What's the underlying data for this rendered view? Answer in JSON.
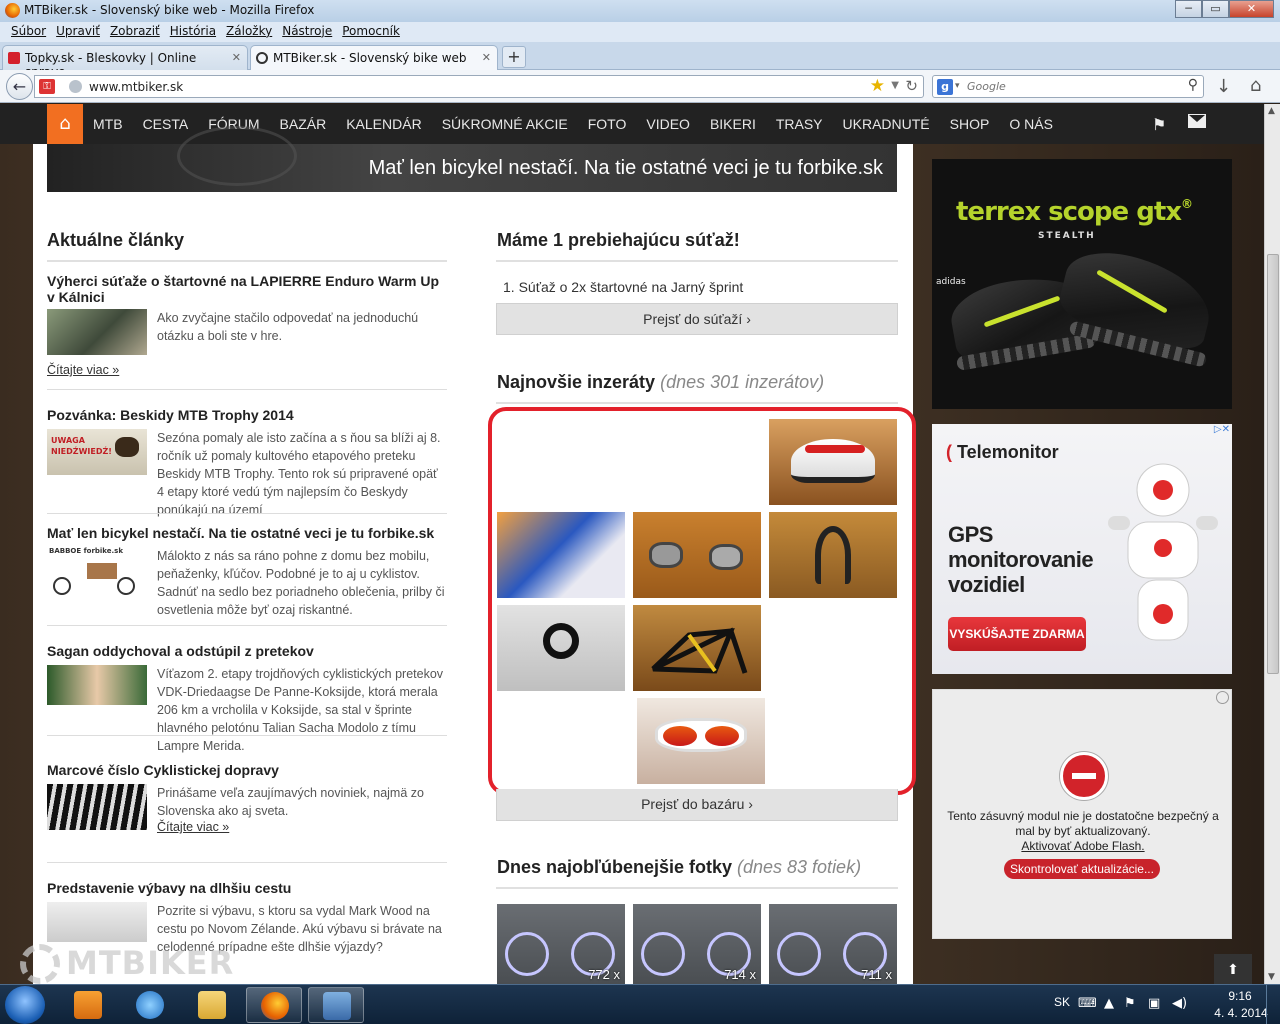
{
  "window": {
    "title": "MTBiker.sk - Slovenský bike web - Mozilla Firefox",
    "minimize": "─",
    "maximize": "▭",
    "close": "✕"
  },
  "menu": [
    "Súbor",
    "Upraviť",
    "Zobraziť",
    "História",
    "Záložky",
    "Nástroje",
    "Pomocník"
  ],
  "tabs": [
    {
      "label": "Topky.sk - Bleskovky | Online spravo...",
      "close": "✕"
    },
    {
      "label": "MTBiker.sk - Slovenský bike web",
      "close": "✕"
    }
  ],
  "new_tab": "+",
  "nav": {
    "back": "←",
    "url": "www.mtbiker.sk",
    "star": "★",
    "reload": "↻",
    "search_placeholder": "Google",
    "search_engine": "g",
    "search_icon": "⚲",
    "download_icon": "↓",
    "home_icon": "⌂"
  },
  "site_nav": {
    "home_icon": "⌂",
    "items": [
      "MTB",
      "CESTA",
      "FÓRUM",
      "BAZÁR",
      "KALENDÁR",
      "SÚKROMNÉ AKCIE",
      "FOTO",
      "VIDEO",
      "BIKERI",
      "TRASY",
      "UKRADNUTÉ",
      "SHOP",
      "O NÁS"
    ],
    "flag_icon": "⚑"
  },
  "banner": {
    "text": "Mať len bicykel nestačí. Na tie ostatné veci je tu forbike.sk"
  },
  "left": {
    "heading": "Aktuálne články",
    "articles": [
      {
        "title": "Výherci súťaže o štartovné na LAPIERRE Enduro Warm Up v Kálnici",
        "excerpt": "Ako zvyčajne stačilo odpovedať na jednoduchú otázku a boli ste v hre.",
        "more": "Čítajte viac »"
      },
      {
        "title": "Pozvánka: Beskidy MTB Trophy 2014",
        "excerpt": "Sezóna pomaly ale isto začína a s ňou sa blíži aj 8. ročník už pomaly kultového etapového preteku Beskidy MTB Trophy. Tento rok sú pripravené opäť 4 etapy ktoré vedú tým najlepsím čo Beskydy ponúkajú na území",
        "thumb_text": "UWAGA NIEDŹWIEDŹ!"
      },
      {
        "title": "Mať len bicykel nestačí. Na tie ostatné veci je tu forbike.sk",
        "excerpt": "Málokto z nás sa ráno pohne z domu bez mobilu, peňaženky, kľúčov. Podobné je to aj u cyklistov. Sadnúť na sedlo bez poriadneho oblečenia, prilby či osvetlenia môže byť ozaj riskantné.",
        "thumb_text": "BABBOE forbike.sk"
      },
      {
        "title": "Sagan oddychoval a odstúpil z pretekov",
        "excerpt": "Víťazom 2. etapy trojdňových cyklistických pretekov VDK-Driedaagse De Panne-Koksijde, ktorá merala 206 km a vrcholila v Koksijde, sa stal v šprinte hlavného pelotónu Talian Sacha Modolo z tímu Lampre Merida."
      },
      {
        "title": "Marcové číslo Cyklistickej dopravy",
        "excerpt": "Prinášame veľa zaujímavých noviniek, najmä zo Slovenska ako aj sveta.",
        "more": "Čítajte viac »"
      },
      {
        "title": "Predstavenie výbavy na dlhšiu cestu",
        "excerpt": "Pozrite si výbavu, s ktoru sa vydal Mark Wood na cestu po Novom Zélande. Akú výbavu si brávate na celodenné prípadne ešte dlhšie výjazdy?"
      }
    ]
  },
  "right": {
    "contest_heading": "Máme 1 prebiehajúcu súťaž!",
    "contest_item": "1.  Súťaž o 2x štartovné na Jarný šprint",
    "contest_button": "Prejsť do súťaží ›",
    "ads_heading": "Najnovšie inzeráty",
    "ads_sub": "(dnes 301 inzerátov)",
    "ads_button": "Prejsť do bazáru ›",
    "photos_heading": "Dnes najobľúbenejšie fotky",
    "photos_sub": "(dnes 83 fotiek)",
    "photos": [
      {
        "count": "772 x"
      },
      {
        "count": "714 x"
      },
      {
        "count": "711 x"
      }
    ]
  },
  "sidebar_ads": {
    "ad1": {
      "headline": "terrex scope gtx",
      "reg": "®",
      "sub": "STEALTH",
      "brand": "adidas"
    },
    "ad2": {
      "brand": "Telemonitor",
      "headline": [
        "GPS",
        "monitorovanie",
        "vozidiel"
      ],
      "cta": "VYSKÚŠAJTE ZDARMA",
      "choices": "▷✕"
    },
    "ad3": {
      "message": "Tento zásuvný modul nie je dostatočne bezpečný a mal by byť aktualizovaný.",
      "link": "Aktivovať Adobe Flash.",
      "button": "Skontrolovať aktualizácie..."
    }
  },
  "to_top": "⬆",
  "watermark": "MTBIKER",
  "taskbar": {
    "lang": "SK",
    "time": "9:16",
    "date": "4. 4. 2014"
  },
  "colors": {
    "accent": "#f26f21",
    "frame": "#e3212b",
    "nav_bg": "#222222"
  }
}
